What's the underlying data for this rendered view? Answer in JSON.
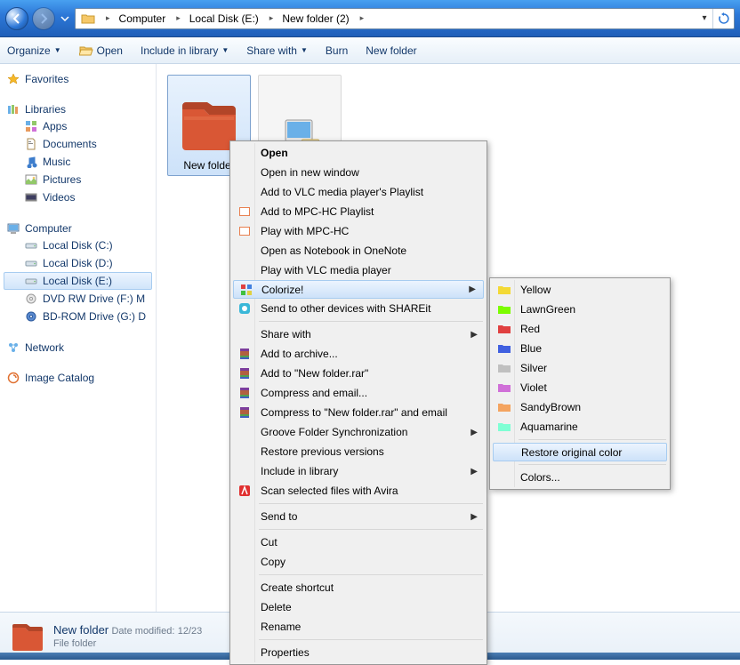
{
  "breadcrumb": {
    "root_icon": "folder",
    "items": [
      "Computer",
      "Local Disk (E:)",
      "New folder (2)"
    ]
  },
  "toolbar": {
    "organize": "Organize",
    "open": "Open",
    "include": "Include in library",
    "share": "Share with",
    "burn": "Burn",
    "newfolder": "New folder"
  },
  "sidebar": {
    "favorites": "Favorites",
    "libraries": "Libraries",
    "lib_items": [
      {
        "label": "Apps",
        "icon": "apps"
      },
      {
        "label": "Documents",
        "icon": "doc"
      },
      {
        "label": "Music",
        "icon": "music"
      },
      {
        "label": "Pictures",
        "icon": "pic"
      },
      {
        "label": "Videos",
        "icon": "vid"
      }
    ],
    "computer": "Computer",
    "comp_items": [
      {
        "label": "Local Disk (C:)",
        "icon": "drive"
      },
      {
        "label": "Local Disk (D:)",
        "icon": "drive"
      },
      {
        "label": "Local Disk (E:)",
        "icon": "drive",
        "selected": true
      },
      {
        "label": "DVD RW Drive (F:)  M",
        "icon": "dvd"
      },
      {
        "label": "BD-ROM Drive (G:) D",
        "icon": "bd"
      }
    ],
    "network": "Network",
    "image_catalog": "Image Catalog"
  },
  "files": {
    "item1_label": "New folder",
    "item2_label": ""
  },
  "details": {
    "title": "New folder",
    "date_label": "Date modified:",
    "date_value": "12/23",
    "type": "File folder"
  },
  "context_menu": {
    "open": "Open",
    "open_new_window": "Open in new window",
    "add_vlc": "Add to VLC media player's Playlist",
    "add_mpc": "Add to MPC-HC Playlist",
    "play_mpc": "Play with MPC-HC",
    "open_onenote": "Open as Notebook in OneNote",
    "play_vlc": "Play with VLC media player",
    "colorize": "Colorize!",
    "shareit": "Send to other devices with SHAREit",
    "share_with": "Share with",
    "add_archive": "Add to archive...",
    "add_newfolder_rar": "Add to \"New folder.rar\"",
    "compress_email": "Compress and email...",
    "compress_newfolder_email": "Compress to \"New folder.rar\" and email",
    "groove": "Groove Folder Synchronization",
    "restore_prev": "Restore previous versions",
    "include_lib": "Include in library",
    "scan_avira": "Scan selected files with Avira",
    "send_to": "Send to",
    "cut": "Cut",
    "copy": "Copy",
    "create_shortcut": "Create shortcut",
    "delete": "Delete",
    "rename": "Rename",
    "properties": "Properties"
  },
  "color_menu": {
    "yellow": "Yellow",
    "lawngreen": "LawnGreen",
    "red": "Red",
    "blue": "Blue",
    "silver": "Silver",
    "violet": "Violet",
    "sandybrown": "SandyBrown",
    "aquamarine": "Aquamarine",
    "restore": "Restore original color",
    "colors": "Colors..."
  },
  "colors": {
    "folder_red": "#d95735",
    "yellow": "#f3d935",
    "lawngreen": "#7cfc00",
    "red": "#e04040",
    "blue": "#4060e0",
    "silver": "#c0c0c0",
    "violet": "#d070d8",
    "sandybrown": "#f4a460",
    "aquamarine": "#7fffd4"
  }
}
